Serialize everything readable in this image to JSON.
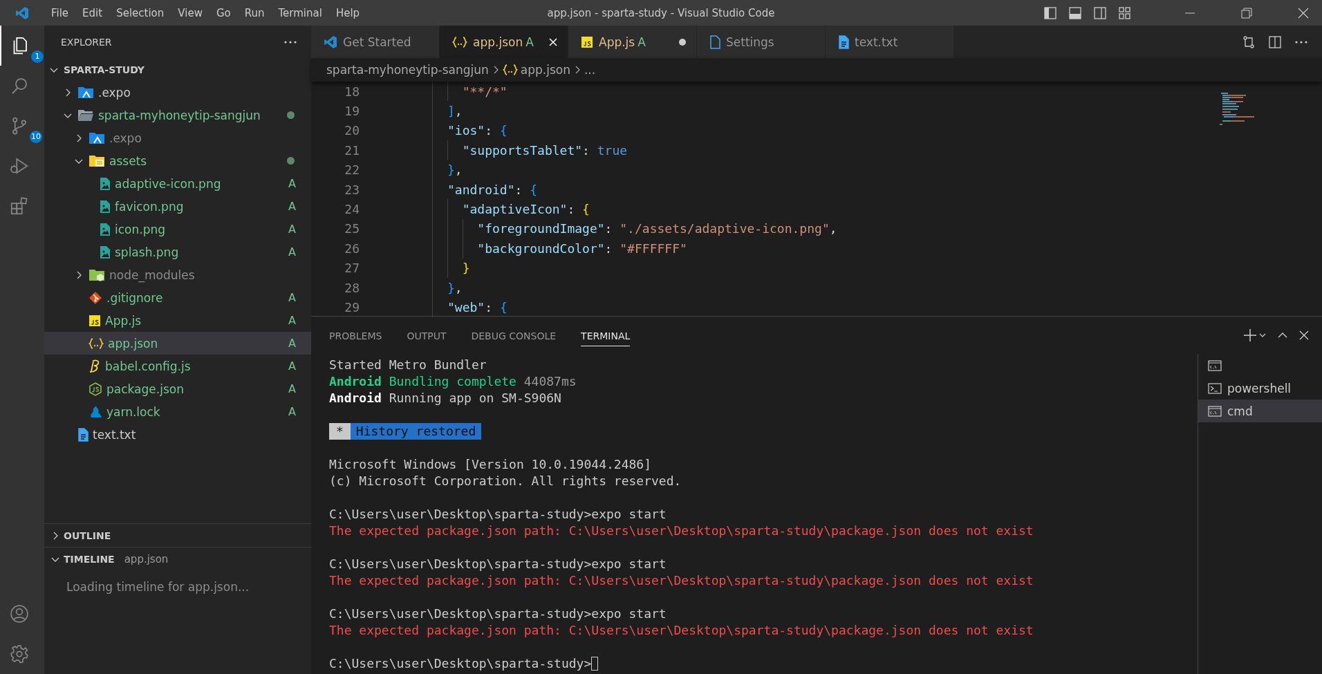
{
  "title_bar": {
    "menu": [
      "File",
      "Edit",
      "Selection",
      "View",
      "Go",
      "Run",
      "Terminal",
      "Help"
    ],
    "title": "app.json - sparta-study - Visual Studio Code"
  },
  "activity_bar": {
    "items": [
      {
        "kind": "files",
        "selected": true,
        "badge": "1"
      },
      {
        "kind": "search",
        "selected": false
      },
      {
        "kind": "source-control",
        "selected": false,
        "badge": "10"
      },
      {
        "kind": "run",
        "selected": false
      },
      {
        "kind": "extensions",
        "selected": false
      }
    ],
    "bottom": [
      {
        "kind": "account"
      },
      {
        "kind": "settings"
      }
    ]
  },
  "sidebar": {
    "title": "EXPLORER",
    "root": {
      "label": "SPARTA-STUDY",
      "expanded": true,
      "children": [
        {
          "label": ".expo",
          "kind": "expo-folder",
          "expanded": false,
          "selected": false
        },
        {
          "label": "sparta-myhoneytip-sangjun",
          "kind": "folder",
          "expanded": true,
          "selected": false,
          "modified": true,
          "children": [
            {
              "label": ".expo",
              "kind": "expo-folder",
              "expanded": false,
              "selected": false,
              "ignored": true
            },
            {
              "label": "assets",
              "kind": "assets-folder",
              "expanded": true,
              "selected": false,
              "modified": true,
              "children": [
                {
                  "label": "adaptive-icon.png",
                  "kind": "image",
                  "status": "A",
                  "selected": false
                },
                {
                  "label": "favicon.png",
                  "kind": "image",
                  "status": "A",
                  "selected": false
                },
                {
                  "label": "icon.png",
                  "kind": "image",
                  "status": "A",
                  "selected": false
                },
                {
                  "label": "splash.png",
                  "kind": "image",
                  "status": "A",
                  "selected": false
                }
              ]
            },
            {
              "label": "node_modules",
              "kind": "node-folder",
              "expanded": false,
              "selected": false,
              "ignored": true
            },
            {
              "label": ".gitignore",
              "kind": "git",
              "status": "A",
              "selected": false
            },
            {
              "label": "App.js",
              "kind": "js",
              "status": "A",
              "selected": false
            },
            {
              "label": "app.json",
              "kind": "json",
              "status": "A",
              "selected": true
            },
            {
              "label": "babel.config.js",
              "kind": "babel",
              "status": "A",
              "selected": false
            },
            {
              "label": "package.json",
              "kind": "nodejs",
              "status": "A",
              "selected": false
            },
            {
              "label": "yarn.lock",
              "kind": "yarn",
              "status": "A",
              "selected": false
            }
          ]
        },
        {
          "label": "text.txt",
          "kind": "text",
          "selected": false
        }
      ]
    },
    "outline": {
      "label": "OUTLINE",
      "expanded": false
    },
    "timeline": {
      "label": "TIMELINE",
      "description": "app.json",
      "expanded": true,
      "message": "Loading timeline for app.json..."
    }
  },
  "editor": {
    "tabs": [
      {
        "label": "Get Started",
        "kind": "vscode",
        "selected": false,
        "dirty": false
      },
      {
        "label": "app.json",
        "kind": "json",
        "status": "A",
        "selected": true,
        "dirty": false
      },
      {
        "label": "App.js",
        "kind": "js",
        "status": "A",
        "selected": false,
        "dirty": true
      },
      {
        "label": "Settings",
        "kind": "settings",
        "selected": false,
        "dirty": false
      },
      {
        "label": "text.txt",
        "kind": "text",
        "selected": false,
        "dirty": false
      }
    ],
    "breadcrumb": [
      {
        "label": "sparta-myhoneytip-sangjun"
      },
      {
        "label": "app.json",
        "kind": "json"
      },
      {
        "label": "..."
      }
    ],
    "lines": [
      {
        "number": "18",
        "tokens": [
          {
            "text": "        \"**/*\"",
            "kind": "string"
          }
        ]
      },
      {
        "number": "19",
        "tokens": [
          {
            "text": "      ]",
            "kind": "brace-a"
          },
          {
            "text": ",",
            "kind": "punct"
          }
        ]
      },
      {
        "number": "20",
        "tokens": [
          {
            "text": "      \"ios\"",
            "kind": "key"
          },
          {
            "text": ": ",
            "kind": "punct"
          },
          {
            "text": "{",
            "kind": "brace-a"
          }
        ]
      },
      {
        "number": "21",
        "tokens": [
          {
            "text": "        \"supportsTablet\"",
            "kind": "key"
          },
          {
            "text": ": ",
            "kind": "punct"
          },
          {
            "text": "true",
            "kind": "keyword"
          }
        ]
      },
      {
        "number": "22",
        "tokens": [
          {
            "text": "      }",
            "kind": "brace-a"
          },
          {
            "text": ",",
            "kind": "punct"
          }
        ]
      },
      {
        "number": "23",
        "tokens": [
          {
            "text": "      \"android\"",
            "kind": "key"
          },
          {
            "text": ": ",
            "kind": "punct"
          },
          {
            "text": "{",
            "kind": "brace-a"
          }
        ]
      },
      {
        "number": "24",
        "tokens": [
          {
            "text": "        \"adaptiveIcon\"",
            "kind": "key"
          },
          {
            "text": ": ",
            "kind": "punct"
          },
          {
            "text": "{",
            "kind": "brace-b"
          }
        ]
      },
      {
        "number": "25",
        "tokens": [
          {
            "text": "          \"foregroundImage\"",
            "kind": "key"
          },
          {
            "text": ": ",
            "kind": "punct"
          },
          {
            "text": "\"./assets/adaptive-icon.png\"",
            "kind": "string"
          },
          {
            "text": ",",
            "kind": "punct"
          }
        ]
      },
      {
        "number": "26",
        "tokens": [
          {
            "text": "          \"backgroundColor\"",
            "kind": "key"
          },
          {
            "text": ": ",
            "kind": "punct"
          },
          {
            "text": "\"#FFFFFF\"",
            "kind": "string"
          }
        ]
      },
      {
        "number": "27",
        "tokens": [
          {
            "text": "        }",
            "kind": "brace-b"
          }
        ]
      },
      {
        "number": "28",
        "tokens": [
          {
            "text": "      }",
            "kind": "brace-a"
          },
          {
            "text": ",",
            "kind": "punct"
          }
        ]
      },
      {
        "number": "29",
        "tokens": [
          {
            "text": "      \"web\"",
            "kind": "key"
          },
          {
            "text": ": ",
            "kind": "punct"
          },
          {
            "text": "{",
            "kind": "brace-a"
          }
        ]
      }
    ]
  },
  "panel": {
    "tabs": [
      {
        "label": "PROBLEMS",
        "selected": false
      },
      {
        "label": "OUTPUT",
        "selected": false
      },
      {
        "label": "DEBUG CONSOLE",
        "selected": false
      },
      {
        "label": "TERMINAL",
        "selected": true
      }
    ],
    "terminal": {
      "blocks": [
        [
          [
            {
              "text": "Started Metro Bundler",
              "kind": "plain"
            }
          ],
          [
            {
              "text": "Android",
              "kind": "green-bold"
            },
            {
              "text": " Bundling complete",
              "kind": "green"
            },
            {
              "text": " 44087ms",
              "kind": "dim"
            }
          ],
          [
            {
              "text": "Android",
              "kind": "bold"
            },
            {
              "text": " Running app on SM-S906N",
              "kind": "plain"
            }
          ]
        ],
        [
          [
            {
              "text": "*",
              "kind": "badge-grey"
            },
            {
              "text": "History restored",
              "kind": "badge-blue"
            }
          ]
        ],
        [
          [
            {
              "text": "Microsoft Windows [Version 10.0.19044.2486]",
              "kind": "plain"
            }
          ],
          [
            {
              "text": "(c) Microsoft Corporation. All rights reserved.",
              "kind": "plain"
            }
          ]
        ],
        [
          [
            {
              "text": "C:\\Users\\user\\Desktop\\sparta-study>expo start",
              "kind": "plain"
            }
          ],
          [
            {
              "text": "The expected package.json path: C:\\Users\\user\\Desktop\\sparta-study\\package.json does not exist",
              "kind": "error"
            }
          ]
        ],
        [
          [
            {
              "text": "C:\\Users\\user\\Desktop\\sparta-study>expo start",
              "kind": "plain"
            }
          ],
          [
            {
              "text": "The expected package.json path: C:\\Users\\user\\Desktop\\sparta-study\\package.json does not exist",
              "kind": "error"
            }
          ]
        ],
        [
          [
            {
              "text": "C:\\Users\\user\\Desktop\\sparta-study>expo start",
              "kind": "plain"
            }
          ],
          [
            {
              "text": "The expected package.json path: C:\\Users\\user\\Desktop\\sparta-study\\package.json does not exist",
              "kind": "error"
            }
          ]
        ],
        [
          [
            {
              "text": "C:\\Users\\user\\Desktop\\sparta-study>",
              "kind": "plain"
            },
            {
              "kind": "cursor"
            }
          ]
        ]
      ]
    },
    "terminals": [
      {
        "kind": "cmd",
        "selected": false
      },
      {
        "label": "powershell",
        "kind": "powershell",
        "selected": false
      },
      {
        "label": "cmd",
        "kind": "cmd",
        "selected": true
      }
    ]
  }
}
